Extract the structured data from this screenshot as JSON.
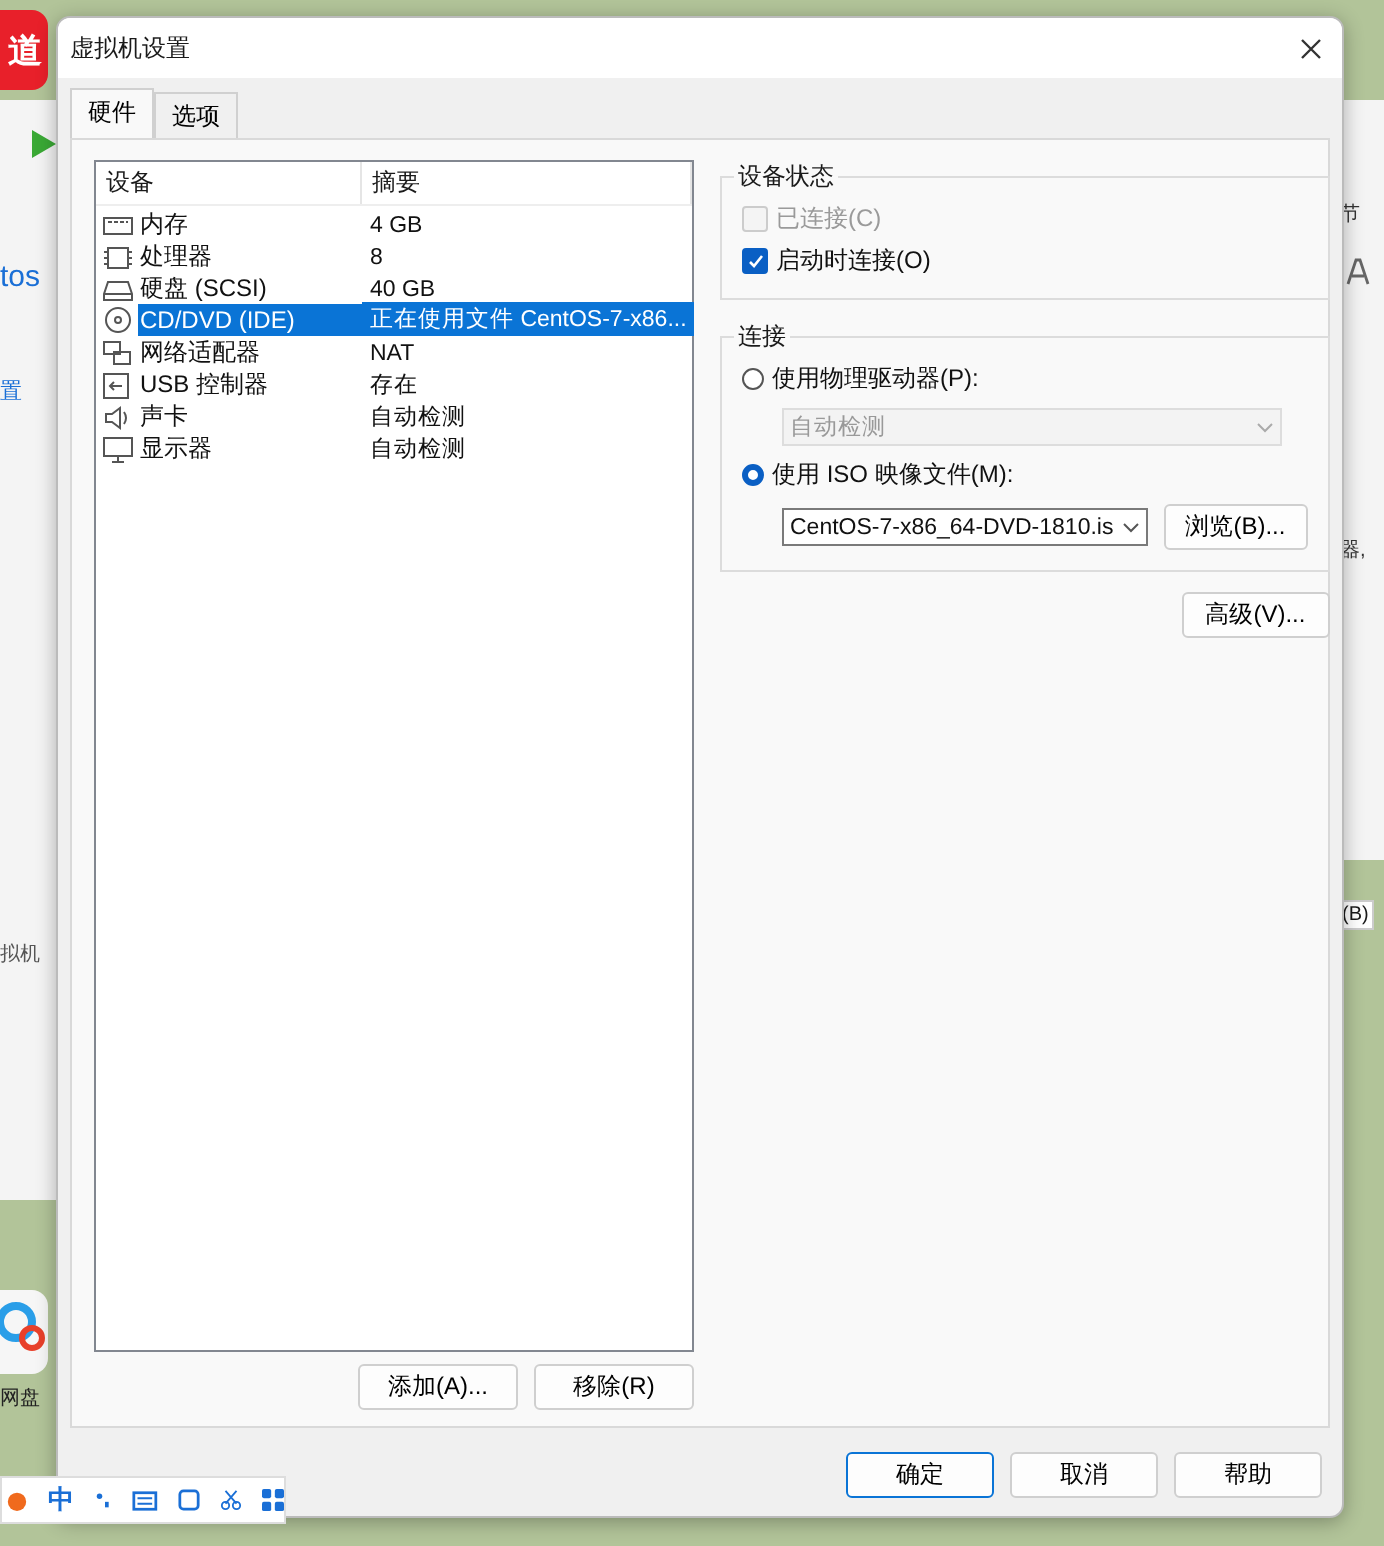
{
  "background": {
    "logo": "道",
    "left_app": {
      "heading": "tos",
      "link": "置",
      "text": "拟机"
    },
    "desktop_icon": {
      "label": "网盘"
    },
    "ime_bar": {
      "mode": "中"
    },
    "right_app": {
      "toolbar_text": "节",
      "body_text": "器,",
      "button": "(B)"
    }
  },
  "dialog": {
    "title": "虚拟机设置",
    "tabs": [
      {
        "label": "硬件",
        "selected": true
      },
      {
        "label": "选项",
        "selected": false
      }
    ],
    "devices": {
      "columns": [
        "设备",
        "摘要"
      ],
      "rows": [
        {
          "kind": "memory",
          "name": "内存",
          "summary": "4 GB",
          "selected": false
        },
        {
          "kind": "cpu",
          "name": "处理器",
          "summary": "8",
          "selected": false
        },
        {
          "kind": "disk",
          "name": "硬盘 (SCSI)",
          "summary": "40 GB",
          "selected": false
        },
        {
          "kind": "cd",
          "name": "CD/DVD (IDE)",
          "summary": "正在使用文件 CentOS-7-x86...",
          "selected": true
        },
        {
          "kind": "network",
          "name": "网络适配器",
          "summary": "NAT",
          "selected": false
        },
        {
          "kind": "usb",
          "name": "USB 控制器",
          "summary": "存在",
          "selected": false
        },
        {
          "kind": "sound",
          "name": "声卡",
          "summary": "自动检测",
          "selected": false
        },
        {
          "kind": "display",
          "name": "显示器",
          "summary": "自动检测",
          "selected": false
        }
      ],
      "buttons": [
        "添加(A)...",
        "移除(R)"
      ]
    },
    "device_status": {
      "title": "设备状态",
      "options": [
        {
          "label": "已连接(C)",
          "checked": false,
          "disabled": true
        },
        {
          "label": "启动时连接(O)",
          "checked": true,
          "disabled": false
        }
      ]
    },
    "connection": {
      "title": "连接",
      "options": [
        {
          "label": "使用物理驱动器(P):",
          "selected": false,
          "dropdown": {
            "value": "自动检测",
            "disabled": true
          }
        },
        {
          "label": "使用 ISO 映像文件(M):",
          "selected": true,
          "dropdown": {
            "value": "CentOS-7-x86_64-DVD-1810.is",
            "disabled": false
          },
          "browse": "浏览(B)..."
        }
      ]
    },
    "advanced": "高级(V)...",
    "footer": [
      {
        "label": "确定",
        "focused": true
      },
      {
        "label": "取消",
        "focused": false
      },
      {
        "label": "帮助",
        "focused": false
      }
    ]
  }
}
